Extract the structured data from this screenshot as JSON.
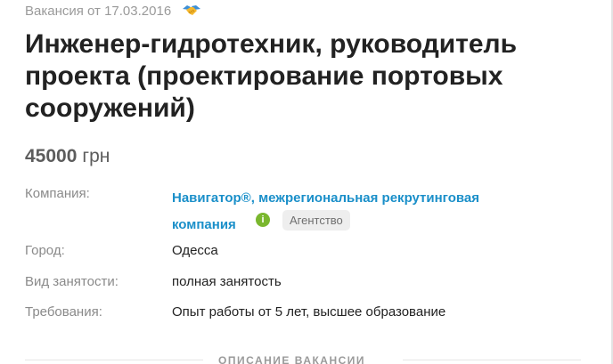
{
  "vacancy": {
    "date_text": "Вакансия от 17.03.2016",
    "title": "Инженер-гидротехник, руководитель проекта (проектирование портовых сооружений)",
    "salary_amount": "45000",
    "salary_currency": "грн",
    "handshake_icon": "handshake-icon"
  },
  "details": {
    "company_label": "Компания:",
    "company_name": "Навигатор®, межрегиональная рекрутинговая компания",
    "verified_icon": "verified-check-icon",
    "verified_color": "#7ab72e",
    "agency_badge": "Агентство",
    "city_label": "Город:",
    "city_value": "Одесса",
    "employment_label": "Вид занятости:",
    "employment_value": "полная занятость",
    "requirements_label": "Требования:",
    "requirements_value": "Опыт работы от 5 лет, высшее образование"
  },
  "section": {
    "description_heading": "ОПИСАНИЕ ВАКАНСИИ"
  },
  "colors": {
    "link": "#1a8fc9",
    "muted_text": "#8a8a8a",
    "badge_bg": "#eeeeee"
  }
}
